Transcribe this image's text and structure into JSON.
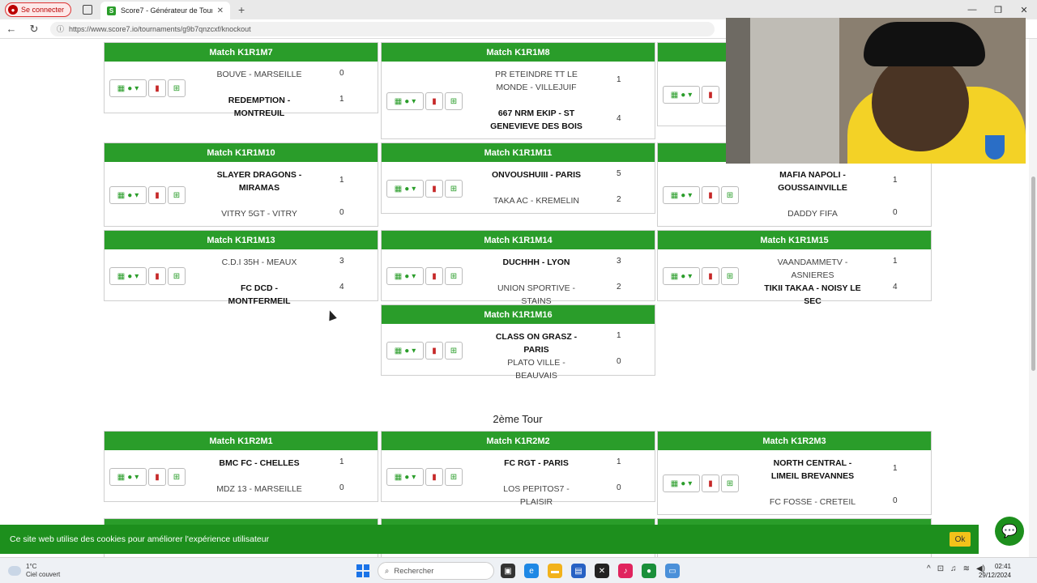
{
  "browser": {
    "signin_label": "Se connecter",
    "tab_title": "Score7 - Générateur de Tournois",
    "url": "https://www.score7.io/tournaments/g9b7qnzcxf/knockout"
  },
  "round2_title": "2ème Tour",
  "matches": [
    {
      "title": "Match K1R1M7",
      "team1": "BOUVE - MARSEILLE",
      "score1": "0",
      "team2": "REDEMPTION - MONTREUIL",
      "score2": "1"
    },
    {
      "title": "Match K1R1M8",
      "team1": "PR ETEINDRE TT LE MONDE - VILLEJUIF",
      "score1": "1",
      "team2": "667 NRM EKIP - ST GENEVIEVE DES BOIS",
      "score2": "4"
    },
    {
      "title": "Match K1R1M10",
      "team1": "SLAYER DRAGONS - MIRAMAS",
      "score1": "1",
      "team2": "VITRY 5GT - VITRY",
      "score2": "0"
    },
    {
      "title": "Match K1R1M11",
      "team1": "ONVOUSHUIII - PARIS",
      "score1": "5",
      "team2": "TAKA AC - KREMELIN",
      "score2": "2"
    },
    {
      "title": "",
      "team1": "MAFIA NAPOLI - GOUSSAINVILLE",
      "score1": "1",
      "team2": "DADDY FIFA",
      "score2": "0"
    },
    {
      "title": "Match K1R1M13",
      "team1": "C.D.I 35H - MEAUX",
      "score1": "3",
      "team2": "FC DCD - MONTFERMEIL",
      "score2": "4"
    },
    {
      "title": "Match K1R1M14",
      "team1": "DUCHHH - LYON",
      "score1": "3",
      "team2": "UNION SPORTIVE - STAINS",
      "score2": "2"
    },
    {
      "title": "Match K1R1M15",
      "team1": "VAANDAMMETV - ASNIERES",
      "score1": "1",
      "team2": "TIKII TAKAA - NOISY LE SEC",
      "score2": "4"
    },
    {
      "title": "Match K1R1M16",
      "team1": "CLASS ON GRASZ - PARIS",
      "score1": "1",
      "team2": "PLATO VILLE - BEAUVAIS",
      "score2": "0"
    },
    {
      "title": "Match K1R2M1",
      "team1": "BMC FC - CHELLES",
      "score1": "1",
      "team2": "MDZ 13 - MARSEILLE",
      "score2": "0"
    },
    {
      "title": "Match K1R2M2",
      "team1": "FC RGT - PARIS",
      "score1": "1",
      "team2": "LOS PEPITOS7 - PLAISIR",
      "score2": "0"
    },
    {
      "title": "Match K1R2M3",
      "team1": "NORTH CENTRAL - LIMEIL BREVANNES",
      "score1": "1",
      "team2": "FC FOSSE - CRETEIL",
      "score2": "0"
    }
  ],
  "cookie": {
    "text": "Ce site web utilise des cookies pour améliorer l'expérience utilisateur",
    "ok": "Ok"
  },
  "taskbar": {
    "temp": "1°C",
    "weather": "Ciel couvert",
    "search_placeholder": "Rechercher",
    "time": "02:41",
    "date": "29/12/2024"
  },
  "icons": {
    "calendar": "calendar-icon",
    "location": "location-pin-icon",
    "whistle": "whistle-icon",
    "delete": "trash-icon",
    "stats": "stats-add-icon"
  }
}
